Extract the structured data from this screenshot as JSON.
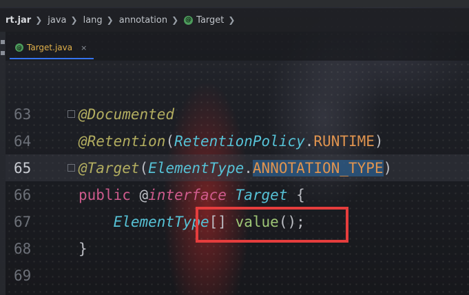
{
  "breadcrumb": {
    "items": [
      "rt.jar",
      "java",
      "lang",
      "annotation",
      "Target"
    ]
  },
  "tab": {
    "label": "Target.java",
    "close": "×"
  },
  "editor": {
    "lines": [
      {
        "number": "63",
        "tokens": [
          "@Documented"
        ]
      },
      {
        "number": "64",
        "tokens": [
          "@Retention",
          "(",
          "RetentionPolicy",
          ".",
          "RUNTIME",
          ")"
        ]
      },
      {
        "number": "65",
        "tokens": [
          "@Target",
          "(",
          "ElementType",
          ".",
          "ANNOTATION_TYPE",
          ")"
        ]
      },
      {
        "number": "66",
        "tokens": [
          "public",
          " @",
          "interface",
          " ",
          "Target",
          " {"
        ]
      },
      {
        "number": "67",
        "tokens": [
          "    ",
          "ElementType",
          "[]",
          " ",
          "value",
          "();"
        ]
      },
      {
        "number": "68",
        "tokens": [
          "}"
        ]
      },
      {
        "number": "69",
        "tokens": []
      }
    ]
  },
  "colors": {
    "highlight_box": "#e53d3d",
    "tab_accent": "#3574f0",
    "annotation_icon": "#4d9c5c"
  }
}
